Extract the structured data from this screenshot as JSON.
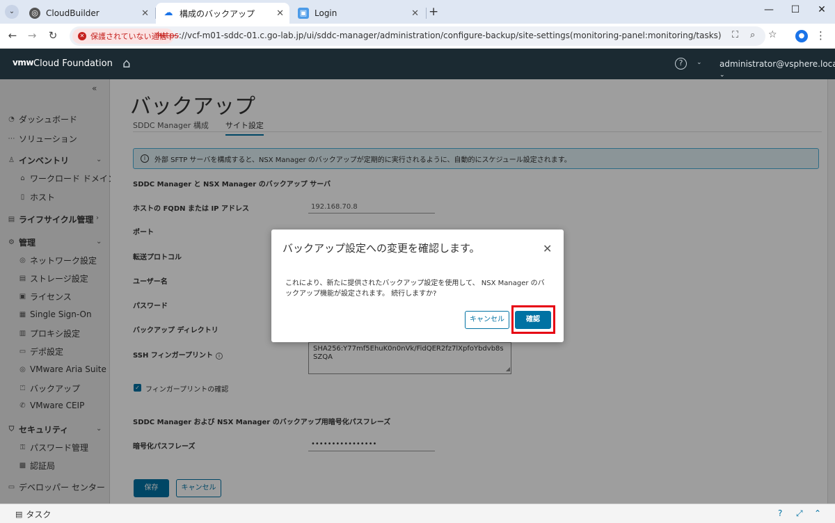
{
  "browser": {
    "tabs": [
      {
        "title": "CloudBuilder",
        "active": false
      },
      {
        "title": "構成のバックアップ",
        "active": true
      },
      {
        "title": "Login",
        "active": false
      }
    ],
    "security_label": "保護されていない通信",
    "url_scheme": "https",
    "url_rest": "://vcf-m01-sddc-01.c.go-lab.jp/ui/sddc-manager/administration/configure-backup/site-settings(monitoring-panel:monitoring/tasks)"
  },
  "header": {
    "logo": "vmw",
    "product": "Cloud Foundation",
    "user": "administrator@vsphere.local"
  },
  "sidebar": {
    "items": [
      {
        "label": "ダッシュボード"
      },
      {
        "label": "ソリューション"
      },
      {
        "label": "インベントリ"
      },
      {
        "label": "ワークロード ドメイン"
      },
      {
        "label": "ホスト"
      },
      {
        "label": "ライフサイクル管理"
      },
      {
        "label": "管理"
      },
      {
        "label": "ネットワーク設定"
      },
      {
        "label": "ストレージ設定"
      },
      {
        "label": "ライセンス"
      },
      {
        "label": "Single Sign-On"
      },
      {
        "label": "プロキシ設定"
      },
      {
        "label": "デポ設定"
      },
      {
        "label": "VMware Aria Suite"
      },
      {
        "label": "バックアップ"
      },
      {
        "label": "VMware CEIP"
      },
      {
        "label": "セキュリティ"
      },
      {
        "label": "パスワード管理"
      },
      {
        "label": "認証局"
      },
      {
        "label": "デベロッパー センター"
      }
    ]
  },
  "page": {
    "title": "バックアップ",
    "tabs": [
      {
        "label": "SDDC Manager 構成"
      },
      {
        "label": "サイト設定"
      }
    ],
    "info": "外部 SFTP サーバを構成すると、NSX Manager のバックアップが定期的に実行されるように、自動的にスケジュール設定されます。",
    "section1": "SDDC Manager と NSX Manager のバックアップ サーバ",
    "fields": {
      "host_label": "ホストの FQDN または IP アドレス",
      "host_value": "192.168.70.8",
      "port_label": "ポート",
      "protocol_label": "転送プロトコル",
      "user_label": "ユーザー名",
      "password_label": "パスワード",
      "dir_label": "バックアップ ディレクトリ",
      "ssh_label": "SSH フィンガープリント",
      "ssh_value": "SHA256:Y77mf5EhuK0n0nVk/FidQER2fz7lXpfoYbdvb8sSZQA",
      "confirm_fp": "フィンガープリントの確認"
    },
    "section2": "SDDC Manager および NSX Manager のバックアップ用暗号化パスフレーズ",
    "passphrase_label": "暗号化パスフレーズ",
    "passphrase_value": "••••••••••••••••",
    "save": "保存",
    "cancel": "キャンセル"
  },
  "modal": {
    "title": "バックアップ設定への変更を確認します。",
    "body": "これにより、新たに提供されたバックアップ設定を使用して、 NSX Manager のバックアップ機能が設定されます。 続行しますか?",
    "cancel": "キャンセル",
    "confirm": "確認"
  },
  "bottom": {
    "task": "タスク"
  }
}
